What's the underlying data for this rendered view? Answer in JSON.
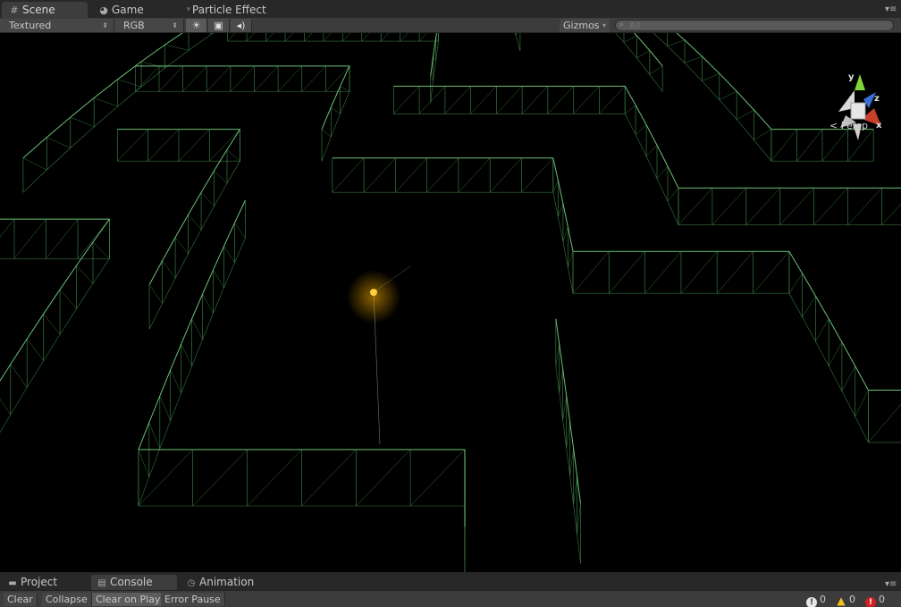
{
  "tabs": [
    {
      "label": "Scene",
      "icon": "grid-icon"
    },
    {
      "label": "Game",
      "icon": "pacman-icon"
    },
    {
      "label": "Particle Effect",
      "icon": "particle-icon"
    }
  ],
  "toolbar": {
    "render_mode": "Textured",
    "color_mode": "RGB",
    "gizmos_label": "Gizmos",
    "search_placeholder": "All"
  },
  "scene": {
    "projection_label": "Persp",
    "axes": {
      "y": "y",
      "z": "z",
      "x": "x"
    },
    "colors": {
      "wire": "#7fe08a",
      "wire_dim": "#3f8a4a",
      "light": "#ffb400",
      "axis_y": "#7fd43a",
      "axis_z": "#3a6fd8",
      "axis_x": "#c8402a"
    }
  },
  "bottom_tabs": [
    {
      "label": "Project",
      "icon": "folder-icon"
    },
    {
      "label": "Console",
      "icon": "console-icon"
    },
    {
      "label": "Animation",
      "icon": "clock-icon"
    }
  ],
  "console": {
    "buttons": [
      "Clear",
      "Collapse",
      "Clear on Play",
      "Error Pause"
    ],
    "info_count": "0",
    "warning_count": "0",
    "error_count": "0"
  }
}
